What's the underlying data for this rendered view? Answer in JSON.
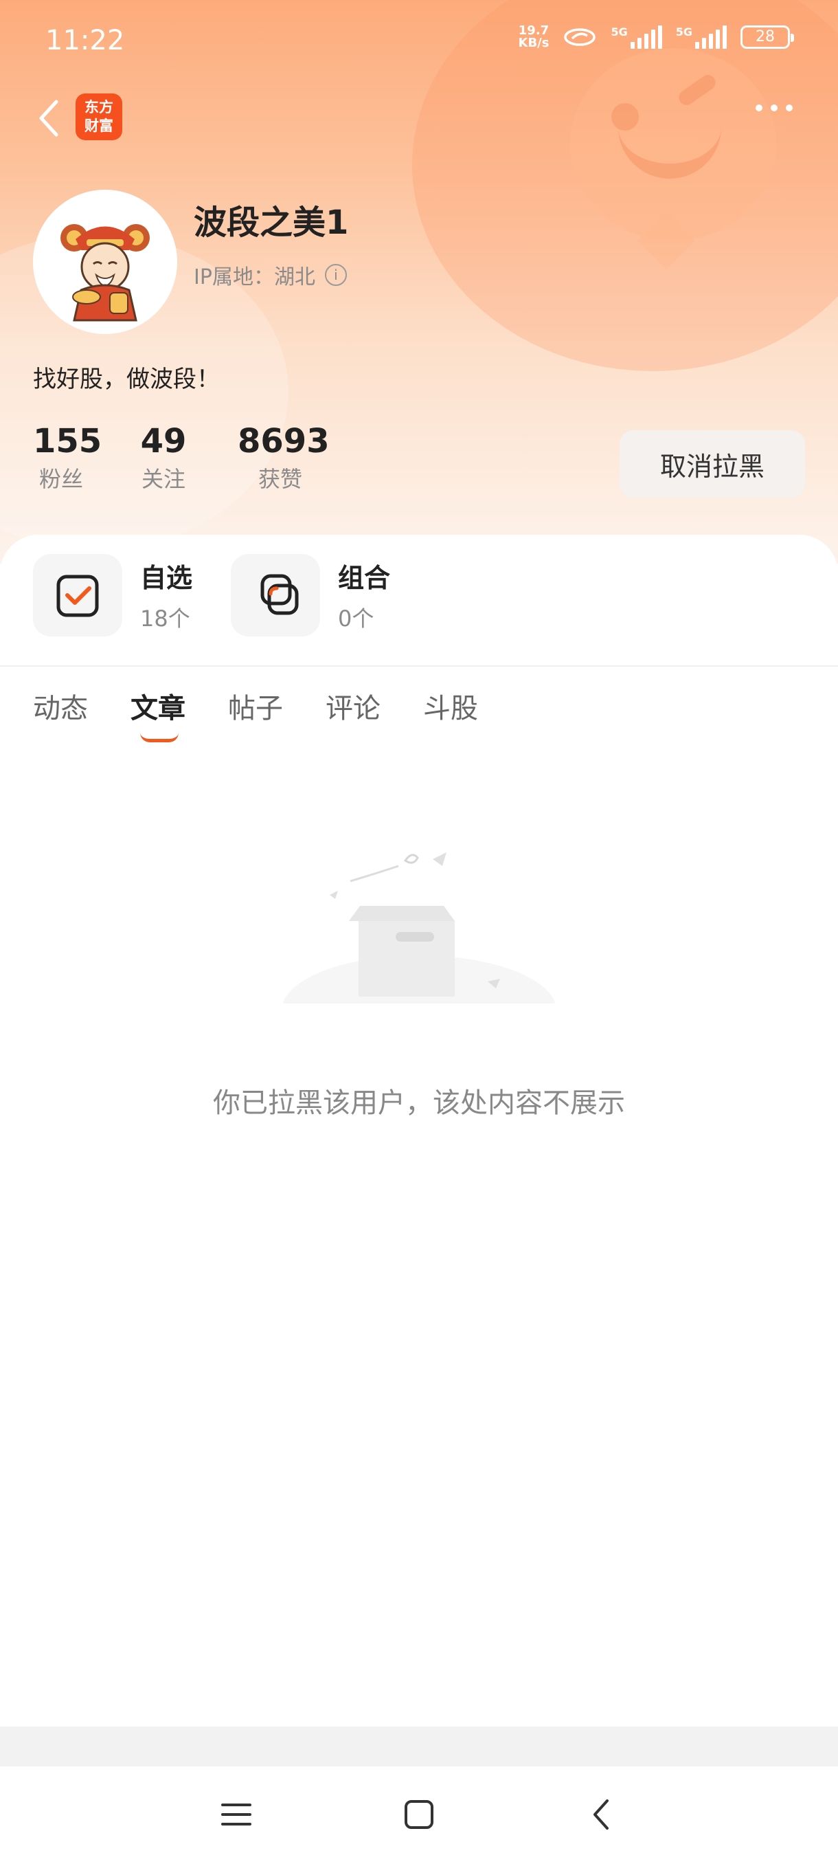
{
  "status_bar": {
    "time": "11:22",
    "net_speed_top": "19.7",
    "net_speed_bottom": "KB/s",
    "signal_label": "5G",
    "signal2_label": "5G",
    "battery": "28"
  },
  "header": {
    "app_logo_line1": "东方",
    "app_logo_line2": "财富"
  },
  "profile": {
    "name": "波段之美1",
    "ip_location": "IP属地：湖北",
    "bio": "找好股，做波段！",
    "stats": [
      {
        "value": "155",
        "label": "粉丝"
      },
      {
        "value": "49",
        "label": "关注"
      },
      {
        "value": "8693",
        "label": "获赞"
      }
    ],
    "unblock_label": "取消拉黑"
  },
  "tiles": [
    {
      "title": "自选",
      "count": "18个"
    },
    {
      "title": "组合",
      "count": "0个"
    }
  ],
  "tabs": [
    {
      "label": "动态"
    },
    {
      "label": "文章"
    },
    {
      "label": "帖子"
    },
    {
      "label": "评论"
    },
    {
      "label": "斗股"
    }
  ],
  "active_tab": "文章",
  "empty_state": {
    "message": "你已拉黑该用户，该处内容不展示"
  },
  "colors": {
    "accent": "#f25a1d",
    "logo_bg": "#f5501d",
    "hero_top": "#fdab7b"
  }
}
